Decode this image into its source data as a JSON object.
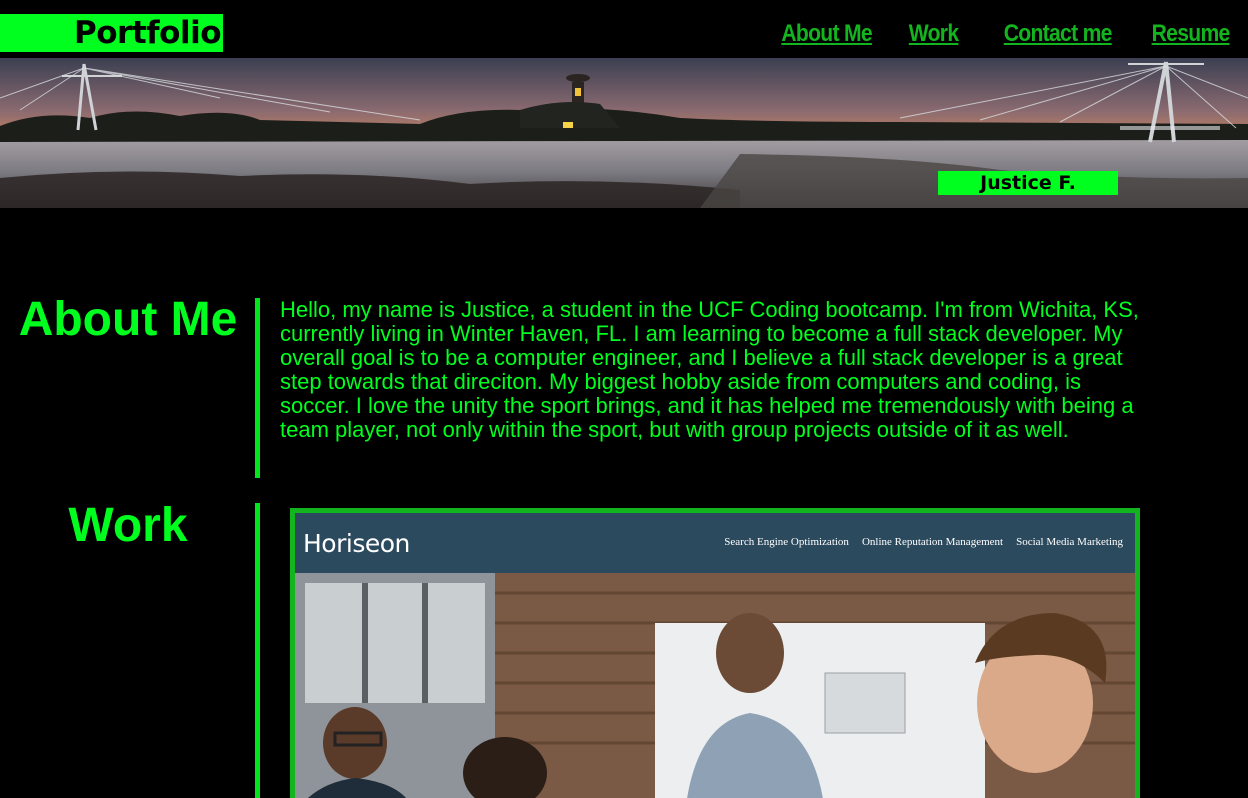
{
  "header": {
    "logo": "Portfolio",
    "nav": [
      "About Me",
      "Work",
      "Contact me",
      "Resume"
    ]
  },
  "hero": {
    "name": "Justice F."
  },
  "about": {
    "title": "About Me",
    "text": "Hello, my name is Justice, a student in the UCF Coding bootcamp. I'm from Wichita, KS, currently living in Winter Haven, FL. I am learning to become a full stack developer. My overall goal is to be a computer engineer, and I believe a full stack developer is a great step towards that direciton. My biggest hobby aside from computers and coding, is soccer. I love the unity the sport brings, and it has helped me tremendously with being a team player, not only within the sport, but with group projects outside of it as well."
  },
  "work": {
    "title": "Work",
    "project": {
      "brand": "Horiseon",
      "nav": [
        "Search Engine Optimization",
        "Online Reputation Management",
        "Social Media Marketing"
      ]
    }
  },
  "colors": {
    "accent": "#00ff1e",
    "nav": "#13b51e",
    "background": "#000000"
  }
}
